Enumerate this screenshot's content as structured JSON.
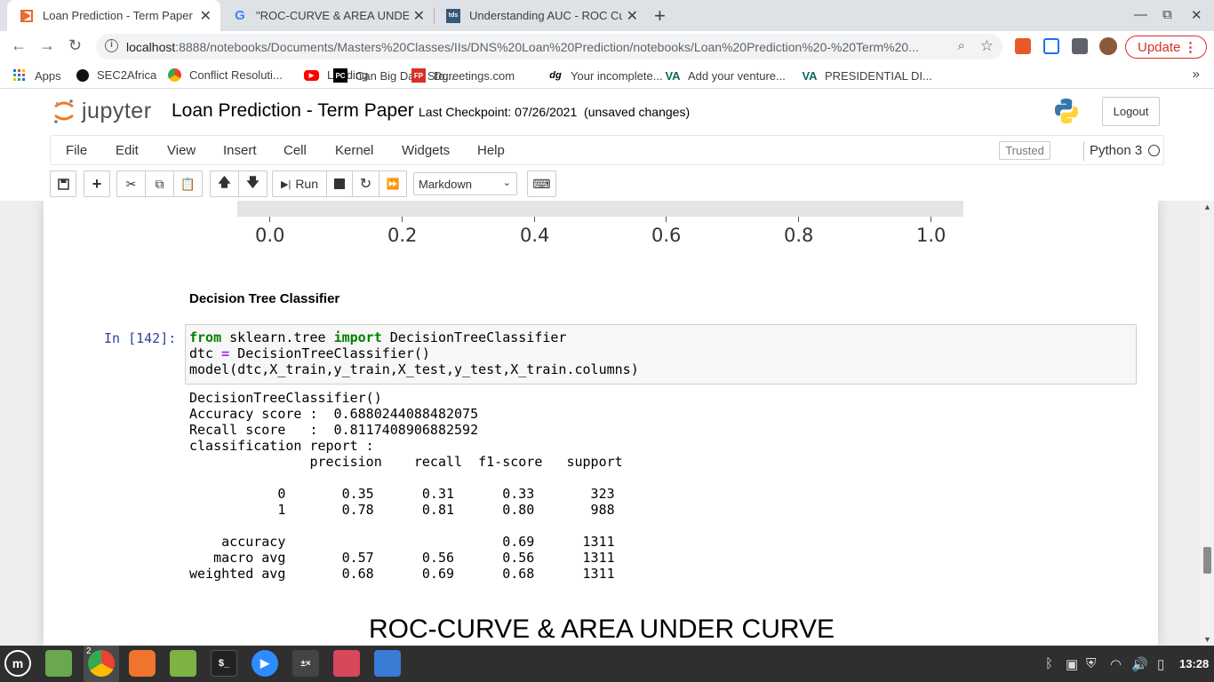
{
  "browser": {
    "tabs": [
      {
        "title": "Loan Prediction - Term Paper",
        "active": true
      },
      {
        "title": "\"ROC-CURVE & AREA UNDER",
        "active": false
      },
      {
        "title": "Understanding AUC - ROC Cur",
        "active": false
      }
    ],
    "url_host": "localhost",
    "url_path": ":8888/notebooks/Documents/Masters%20Classes/IIs/DNS%20Loan%20Prediction/notebooks/Loan%20Prediction%20-%20Term%20...",
    "update_label": "Update",
    "bookmarks": [
      {
        "label": "Apps",
        "icon": "apps-grid-icon"
      },
      {
        "label": "SEC2Africa",
        "icon": "sec2africa-icon"
      },
      {
        "label": "Conflict Resoluti...",
        "icon": "chrome-icon"
      },
      {
        "label": "Loading",
        "icon": "youtube-icon"
      },
      {
        "label": "Can Big Data Sto...",
        "icon": "pycharm-icon"
      },
      {
        "label": "Dgreetings.com",
        "icon": "fp-icon"
      },
      {
        "label": "Your incomplete...",
        "icon": "dg-icon"
      },
      {
        "label": "Add your venture...",
        "icon": "va-icon"
      },
      {
        "label": "PRESIDENTIAL DI...",
        "icon": "document-icon"
      }
    ],
    "colors": {
      "tabstrip": "#dee1e6",
      "update_red": "#d93025"
    }
  },
  "jupyter": {
    "logo_text": "jupyter",
    "notebook_title": "Loan Prediction - Term Paper",
    "checkpoint": "Last Checkpoint: 07/26/2021",
    "save_state": "(unsaved changes)",
    "logout_label": "Logout",
    "menu": [
      "File",
      "Edit",
      "View",
      "Insert",
      "Cell",
      "Kernel",
      "Widgets",
      "Help"
    ],
    "trusted_label": "Trusted",
    "kernel_name": "Python 3",
    "run_label": "Run",
    "cell_type": "Markdown"
  },
  "notebook": {
    "plot_x_ticks": [
      "0.0",
      "0.2",
      "0.4",
      "0.6",
      "0.8",
      "1.0"
    ],
    "markdown_heading": "Decision Tree Classifier",
    "prompt": "In [142]:",
    "output_lines": [
      "DecisionTreeClassifier()",
      "Accuracy score :  0.6880244088482075",
      "Recall score   :  0.8117408906882592",
      "classification report :",
      "               precision    recall  f1-score   support",
      "",
      "           0       0.35      0.31      0.33       323",
      "           1       0.78      0.81      0.80       988",
      "",
      "    accuracy                           0.69      1311",
      "   macro avg       0.57      0.56      0.56      1311",
      "weighted avg       0.68      0.69      0.68      1311"
    ],
    "next_heading": "ROC-CURVE & AREA UNDER CURVE"
  },
  "taskbar": {
    "chrome_badge": "2",
    "clock": "13:28"
  }
}
